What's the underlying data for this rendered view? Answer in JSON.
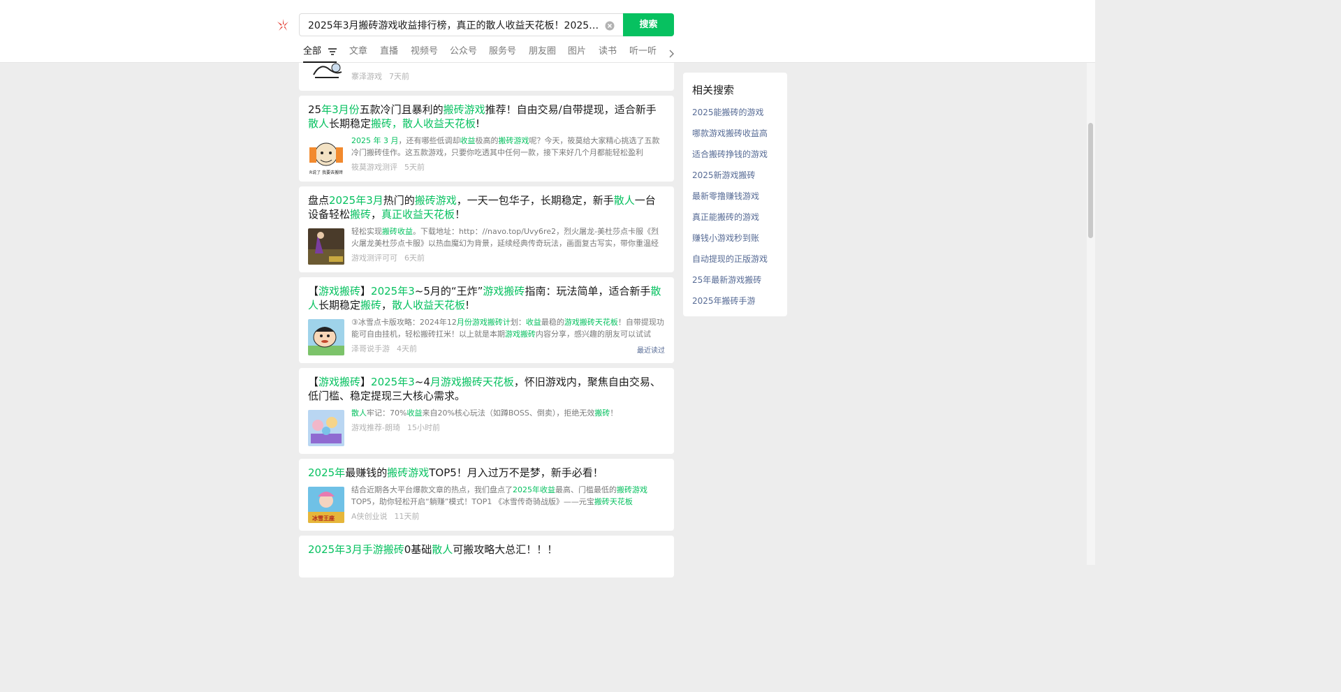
{
  "search": {
    "query": "2025年3月搬砖游戏收益排行榜，真正的散人收益天花板！2025年...",
    "button_label": "搜索"
  },
  "tabs": [
    {
      "label": "全部"
    },
    {
      "label": "文章"
    },
    {
      "label": "直播"
    },
    {
      "label": "视频号"
    },
    {
      "label": "公众号"
    },
    {
      "label": "服务号"
    },
    {
      "label": "朋友圈"
    },
    {
      "label": "图片"
    },
    {
      "label": "读书"
    },
    {
      "label": "听一听"
    }
  ],
  "results": [
    {
      "meta_source": "寨泽游戏",
      "meta_time": "7天前"
    },
    {
      "title_parts": [
        [
          "25",
          ""
        ],
        [
          "年3月份",
          "hl"
        ],
        [
          "五款冷门且暴利的",
          ""
        ],
        [
          "搬砖游戏",
          "hl"
        ],
        [
          "推荐！自由交易/自带提现，适合新手",
          ""
        ],
        [
          "散人",
          "hl"
        ],
        [
          "长期稳定",
          ""
        ],
        [
          "搬砖，散人收益天花板",
          "hl"
        ],
        [
          "!",
          ""
        ]
      ],
      "snippet_parts": [
        [
          "2025 年 3 月",
          "hl"
        ],
        [
          "，还有哪些低调却",
          ""
        ],
        [
          "收益",
          "hl"
        ],
        [
          "极高的",
          ""
        ],
        [
          "搬砖游戏",
          "hl"
        ],
        [
          "呢？今天，筱莫给大家精心挑选了五款冷门搬砖佳作。这五款游戏，只要你吃透其中任何一款，接下来好几个月都能轻松盈利",
          ""
        ]
      ],
      "meta_source": "筱莫游戏测评",
      "meta_time": "5天前"
    },
    {
      "title_parts": [
        [
          "盘点",
          ""
        ],
        [
          "2025年3月",
          "hl"
        ],
        [
          "热门的",
          ""
        ],
        [
          "搬砖游戏",
          "hl"
        ],
        [
          "，一天一包华子，长期稳定，新手",
          ""
        ],
        [
          "散人",
          "hl"
        ],
        [
          "一台设备轻松",
          ""
        ],
        [
          "搬砖",
          "hl"
        ],
        [
          "，",
          ""
        ],
        [
          "真正收益天花板",
          "hl"
        ],
        [
          "！",
          ""
        ]
      ],
      "snippet_parts": [
        [
          "轻松实现",
          ""
        ],
        [
          "搬砖收益",
          "hl"
        ],
        [
          "。下载地址：http：//navo.top/Uvy6re2，烈火屠龙-美杜莎点卡服《烈火屠龙美杜莎点卡服》以热血魔幻为背景，延续经典传奇玩法，画面复古写实，带你重温经典",
          ""
        ]
      ],
      "meta_source": "游戏测评可可",
      "meta_time": "6天前"
    },
    {
      "title_parts": [
        [
          "【",
          ""
        ],
        [
          "游戏搬砖",
          "hl"
        ],
        [
          "】",
          ""
        ],
        [
          "2025年3",
          "hl"
        ],
        [
          "~5月的“王炸”",
          ""
        ],
        [
          "游戏搬砖",
          "hl"
        ],
        [
          "指南：玩法简单，适合新手",
          ""
        ],
        [
          "散人",
          "hl"
        ],
        [
          "长期稳定",
          ""
        ],
        [
          "搬砖",
          "hl"
        ],
        [
          "，",
          ""
        ],
        [
          "散人收益天花板",
          "hl"
        ],
        [
          "!",
          ""
        ]
      ],
      "snippet_parts": [
        [
          "③冰雪点卡版攻略：2024年12",
          ""
        ],
        [
          "月份游戏搬砖计",
          "hl"
        ],
        [
          "划：",
          ""
        ],
        [
          "收益",
          "hl"
        ],
        [
          "最稳的",
          ""
        ],
        [
          "游戏搬砖天花板",
          "hl"
        ],
        [
          "！自带提现功能可自由挂机，轻松搬砖扛米！以上就是本期",
          ""
        ],
        [
          "游戏搬砖",
          "hl"
        ],
        [
          "内容分享，感兴趣的朋友可以试试",
          ""
        ]
      ],
      "meta_source": "泽哥说手游",
      "meta_time": "4天前",
      "recent_label": "最近读过"
    },
    {
      "title_parts": [
        [
          "【",
          ""
        ],
        [
          "游戏搬砖",
          "hl"
        ],
        [
          "】",
          ""
        ],
        [
          "2025年3",
          "hl"
        ],
        [
          "~4",
          ""
        ],
        [
          "月游戏搬砖天花板",
          "hl"
        ],
        [
          "，怀旧游戏内，聚焦自由交易、低门槛、稳定提现三大核心需求。",
          ""
        ]
      ],
      "snippet_parts": [
        [
          "散人",
          "hl"
        ],
        [
          "牢记：70%",
          ""
        ],
        [
          "收益",
          "hl"
        ],
        [
          "来自20%核心玩法（如蹲BOSS、倒卖），拒绝无效",
          ""
        ],
        [
          "搬砖",
          "hl"
        ],
        [
          "！",
          ""
        ]
      ],
      "meta_source": "游戏推荐-朗琦",
      "meta_time": "15小时前"
    },
    {
      "title_parts": [
        [
          "2025年",
          "hl"
        ],
        [
          "最赚钱的",
          ""
        ],
        [
          "搬砖游戏",
          "hl"
        ],
        [
          "TOP5！月入过万不是梦，新手必看！",
          ""
        ]
      ],
      "snippet_parts": [
        [
          "结合近期各大平台爆款文章的热点，我们盘点了",
          ""
        ],
        [
          "2025年收益",
          "hl"
        ],
        [
          "最高、门槛最低的",
          ""
        ],
        [
          "搬砖游戏",
          "hl"
        ],
        [
          "TOP5，助你轻松开启“躺赚”模式！TOP1 《冰雪传奇骑战版》——元宝",
          ""
        ],
        [
          "搬砖天花板",
          "hl"
        ]
      ],
      "meta_source": "A侠创业说",
      "meta_time": "11天前"
    },
    {
      "title_parts": [
        [
          "2025年3月手游搬砖",
          "hl"
        ],
        [
          "0基础",
          ""
        ],
        [
          "散人",
          "hl"
        ],
        [
          "可搬攻略大总汇！！！",
          ""
        ]
      ]
    }
  ],
  "sidebar": {
    "title": "相关搜索",
    "items": [
      "2025能搬砖的游戏",
      "哪款游戏搬砖收益高",
      "适合搬砖挣钱的游戏",
      "2025新游戏搬砖",
      "最新零撸赚钱游戏",
      "真正能搬砖的游戏",
      "赚钱小游戏秒到账",
      "自动提现的正版游戏",
      "25年最新游戏搬砖",
      "2025年搬砖手游"
    ]
  },
  "colors": {
    "accent": "#07c160",
    "link": "#576b95",
    "background": "#ededed"
  }
}
